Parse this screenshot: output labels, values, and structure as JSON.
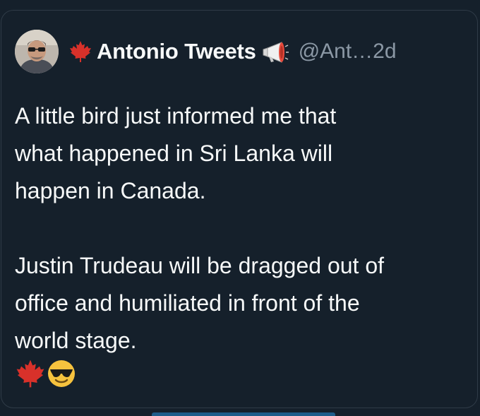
{
  "tweet": {
    "author": {
      "display_name": "Antonio Tweets",
      "handle": "@Ant…",
      "time": "2d"
    },
    "text_lines": [
      "A little bird just informed me that",
      "what happened in Sri Lanka will",
      "happen in Canada.",
      "Justin Trudeau will be dragged out of",
      "office and humiliated in front of the",
      "world stage."
    ],
    "icons": {
      "name_prefix": "maple-leaf-icon",
      "name_suffix": "megaphone-icon",
      "footer": [
        "maple-leaf-icon",
        "sunglasses-face-icon"
      ]
    }
  },
  "colors": {
    "background": "#15202b",
    "text": "#f7f9f9",
    "secondary": "#8b98a5",
    "maple": "#d8312a"
  }
}
